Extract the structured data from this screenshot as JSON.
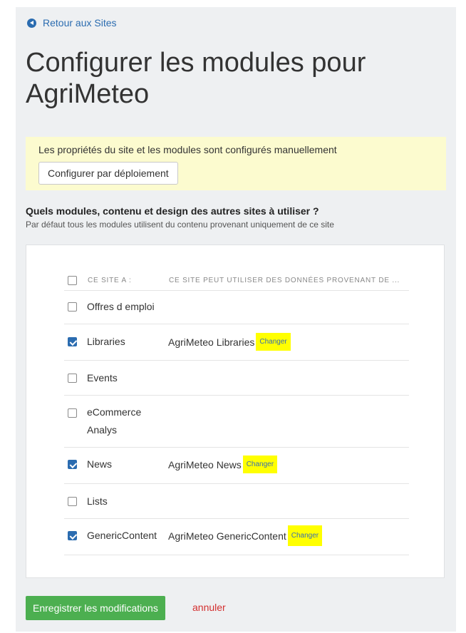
{
  "back_link": "Retour aux Sites",
  "title": "Configurer les modules pour AgriMeteo",
  "notice": {
    "text": "Les propriétés du site et les modules sont configurés manuellement",
    "button": "Configurer par déploiement"
  },
  "question": {
    "title": "Quels modules, contenu et design des autres sites à utiliser ?",
    "subtitle": "Par défaut tous les modules utilisent du contenu provenant uniquement de ce site"
  },
  "table": {
    "col1": "CE SITE A :",
    "col2": "CE SITE PEUT UTILISER DES DONNÉES PROVENANT DE ...",
    "rows": [
      {
        "module": "Offres d emploi",
        "checked": false,
        "source": "",
        "change": ""
      },
      {
        "module": "Libraries",
        "checked": true,
        "source": "AgriMeteo Libraries",
        "change": "Changer"
      },
      {
        "module": "Events",
        "checked": false,
        "source": "",
        "change": ""
      },
      {
        "module": "eCommerce Analys",
        "checked": false,
        "source": "",
        "change": ""
      },
      {
        "module": "News",
        "checked": true,
        "source": "AgriMeteo News",
        "change": "Changer"
      },
      {
        "module": "Lists",
        "checked": false,
        "source": "",
        "change": ""
      },
      {
        "module": "GenericContent",
        "checked": true,
        "source": "AgriMeteo GenericContent",
        "change": "Changer"
      }
    ]
  },
  "actions": {
    "save": "Enregistrer les modifications",
    "cancel": "annuler"
  },
  "colors": {
    "link": "#2b6cb0",
    "checkbox": "#2b6cb0",
    "notice_bg": "#fcfbcf",
    "highlight": "#ffff00",
    "save_bg": "#4caf50",
    "cancel": "#d32f2f"
  },
  "icons": {
    "back": "circle-arrow-left-icon"
  }
}
